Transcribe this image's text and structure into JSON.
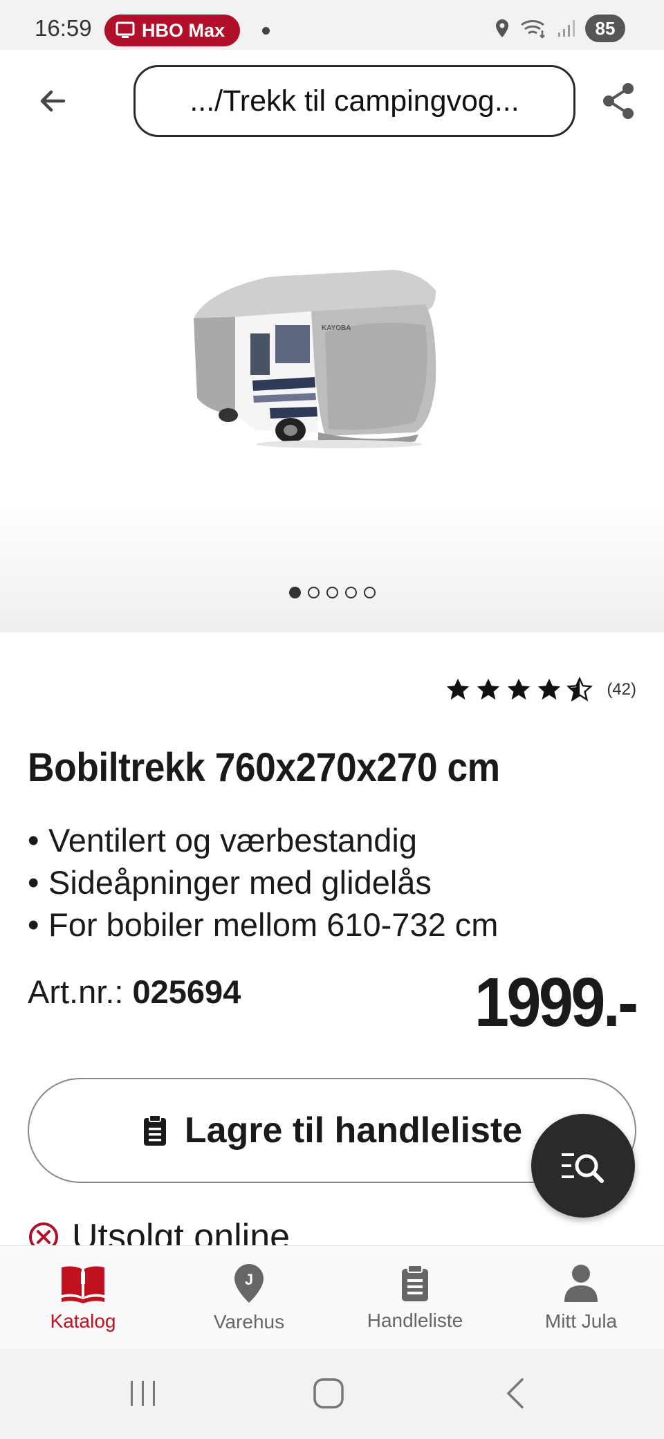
{
  "status_bar": {
    "time": "16:59",
    "app_pill": "HBO Max",
    "battery": "85"
  },
  "topnav": {
    "url": ".../Trekk til campingvog..."
  },
  "gallery": {
    "image_count": 5,
    "active_index": 0,
    "image_brand_text": "KAYOBA"
  },
  "product": {
    "rating_value": 4.5,
    "rating_count": "(42)",
    "title": "Bobiltrekk 760x270x270 cm",
    "bullets": [
      "Ventilert og værbestandig",
      "Sideåpninger med glidelås",
      "For bobiler mellom 610-732 cm"
    ],
    "artnr_label": "Art.nr.:",
    "artnr_value": "025694",
    "price": "1999.-",
    "save_button_label": "Lagre til handleliste",
    "stock_status": "Utsolgt online"
  },
  "bottom_nav": {
    "items": [
      {
        "label": "Katalog",
        "icon": "book-open-icon",
        "active": true
      },
      {
        "label": "Varehus",
        "icon": "map-pin-icon",
        "active": false
      },
      {
        "label": "Handleliste",
        "icon": "clipboard-list-icon",
        "active": false
      },
      {
        "label": "Mitt Jula",
        "icon": "person-icon",
        "active": false
      }
    ]
  },
  "colors": {
    "accent_red": "#c0111f",
    "hbo_pill": "#b0102a",
    "dark": "#2a2a2a"
  }
}
